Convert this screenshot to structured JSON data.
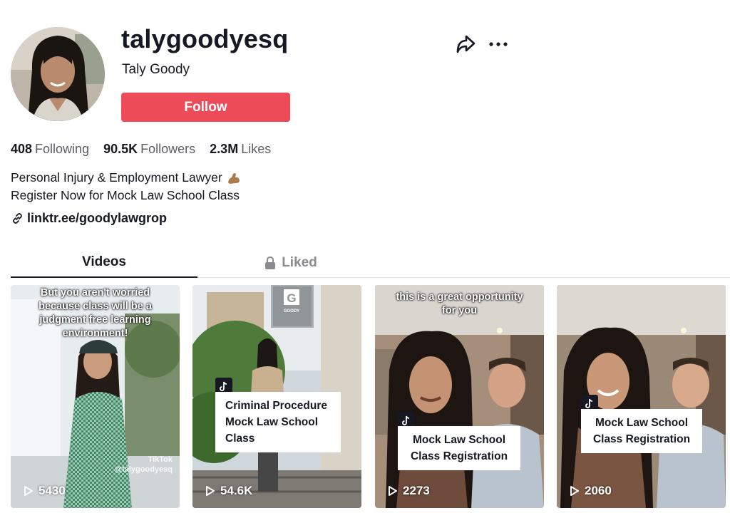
{
  "profile": {
    "username": "talygoodyesq",
    "display_name": "Taly Goody",
    "follow_label": "Follow"
  },
  "stats": [
    {
      "value": "408",
      "label": "Following"
    },
    {
      "value": "90.5K",
      "label": "Followers"
    },
    {
      "value": "2.3M",
      "label": "Likes"
    }
  ],
  "bio": {
    "line1": "Personal Injury & Employment Lawyer",
    "line1_emoji": "flexed-biceps-icon",
    "line2": "Register Now for Mock Law School Class"
  },
  "link": {
    "text": "linktr.ee/goodylawgrop",
    "icon": "link-icon"
  },
  "tabs": [
    {
      "label": "Videos",
      "active": true
    },
    {
      "label": "Liked",
      "active": false,
      "icon": "lock-icon"
    }
  ],
  "videos": [
    {
      "overlay": "But you aren't worried because class will be a judgment free learning environment!",
      "views": "5430",
      "watermark_brand": "TikTok",
      "watermark_handle": "@talygoodyesq"
    },
    {
      "label": "Criminal Procedure Mock Law School Class",
      "views": "54.6K",
      "sign_letter": "G",
      "sign_name": "GOODY"
    },
    {
      "overlay": "this is a great opportunity for you",
      "label": "Mock Law School Class Registration",
      "views": "2273"
    },
    {
      "label": "Mock Law School Class Registration",
      "views": "2060"
    }
  ],
  "colors": {
    "follow_button": "#ee4b59",
    "text_primary": "#161823",
    "text_secondary": "#5c5e67",
    "tab_inactive": "#8a8b91"
  }
}
